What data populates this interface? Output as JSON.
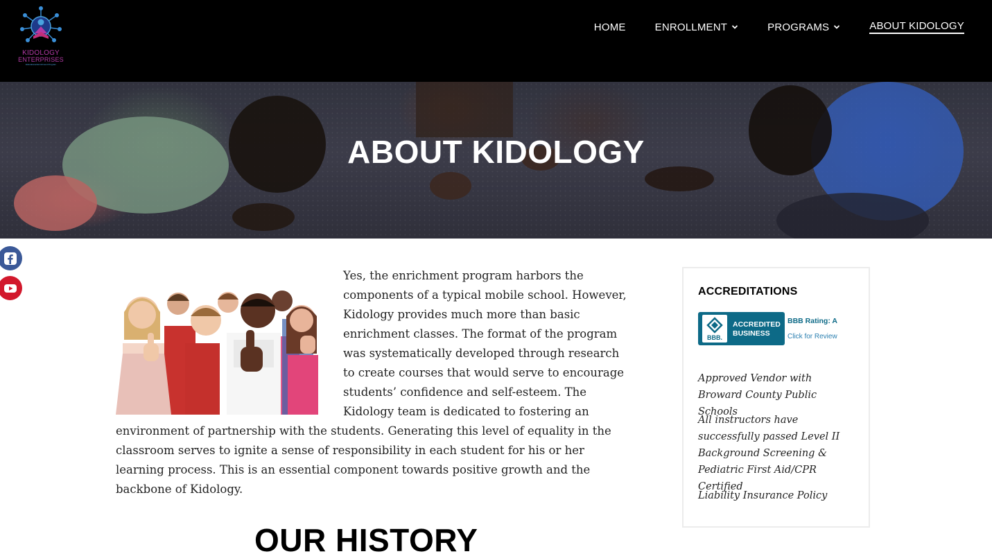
{
  "logo": {
    "line1": "KIDOLOGY",
    "line2": "ENTERPRISES",
    "line3": "Educational Enrichment Program"
  },
  "nav": {
    "items": [
      {
        "label": "HOME",
        "has_dropdown": false,
        "active": false
      },
      {
        "label": "ENROLLMENT",
        "has_dropdown": true,
        "active": false
      },
      {
        "label": "PROGRAMS",
        "has_dropdown": true,
        "active": false
      },
      {
        "label": "ABOUT KIDOLOGY",
        "has_dropdown": false,
        "active": true
      }
    ]
  },
  "hero": {
    "title": "ABOUT KIDOLOGY"
  },
  "social": {
    "facebook_icon": "facebook-icon",
    "youtube_icon": "youtube-icon",
    "facebook_color": "#3b5998",
    "youtube_color": "#d2182c"
  },
  "main": {
    "intro": "Yes, the enrichment program harbors the components of a typical mobile school.  However, Kidology provides much more than basic enrichment classes.  The format of the program was systematically developed through research to create courses that would serve to encourage students’ confidence and self-esteem.  The Kidology team is dedicated to fostering an environment of partnership with the students.  Generating this level of equality in the classroom serves to ignite a sense of responsibility in each student for his or her learning process.  This is an essential component towards positive growth and the backbone of Kidology.",
    "history_title": "OUR HISTORY"
  },
  "sidebar": {
    "title": "ACCREDITATIONS",
    "bbb": {
      "logo_text": "BBB.",
      "accredited_line1": "ACCREDITED",
      "accredited_line2": "BUSINESS",
      "rating": "BBB Rating: A",
      "review_link": "Click for Review",
      "color": "#0d6a87"
    },
    "items": [
      "Approved Vendor with Broward County Public Schools",
      "All instructors have successfully passed Level II Background Screening & Pediatric First Aid/CPR Certified",
      "Liability Insurance Policy"
    ]
  },
  "colors": {
    "header_bg": "#000000",
    "brand_pink": "#b23aa5",
    "brand_blue": "#4aa3df"
  }
}
